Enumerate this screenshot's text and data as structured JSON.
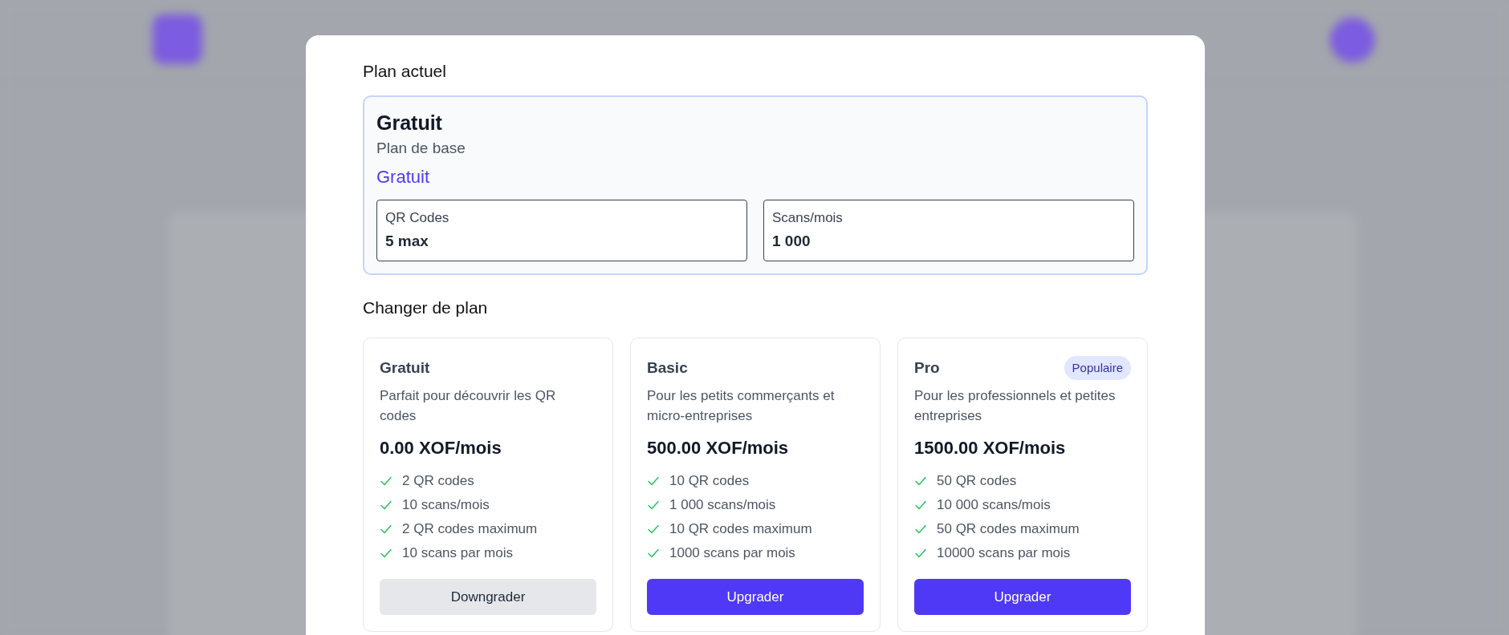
{
  "current_plan": {
    "heading": "Plan actuel",
    "name": "Gratuit",
    "description": "Plan de base",
    "price": "Gratuit",
    "stats": [
      {
        "label": "QR Codes",
        "value": "5 max"
      },
      {
        "label": "Scans/mois",
        "value": "1 000"
      }
    ]
  },
  "change_plan": {
    "heading": "Changer de plan",
    "plans": [
      {
        "name": "Gratuit",
        "description": "Parfait pour découvrir les QR codes",
        "price": "0.00 XOF/mois",
        "features": [
          "2 QR codes",
          "10 scans/mois",
          "2 QR codes maximum",
          "10 scans par mois"
        ],
        "button": {
          "label": "Downgrader",
          "kind": "secondary"
        }
      },
      {
        "name": "Basic",
        "description": "Pour les petits commerçants et micro-entreprises",
        "price": "500.00 XOF/mois",
        "features": [
          "10 QR codes",
          "1 000 scans/mois",
          "10 QR codes maximum",
          "1000 scans par mois"
        ],
        "button": {
          "label": "Upgrader",
          "kind": "primary"
        }
      },
      {
        "name": "Pro",
        "badge": "Populaire",
        "description": "Pour les professionnels et petites entreprises",
        "price": "1500.00 XOF/mois",
        "features": [
          "50 QR codes",
          "10 000 scans/mois",
          "50 QR codes maximum",
          "10000 scans par mois"
        ],
        "button": {
          "label": "Upgrader",
          "kind": "primary"
        }
      }
    ]
  }
}
